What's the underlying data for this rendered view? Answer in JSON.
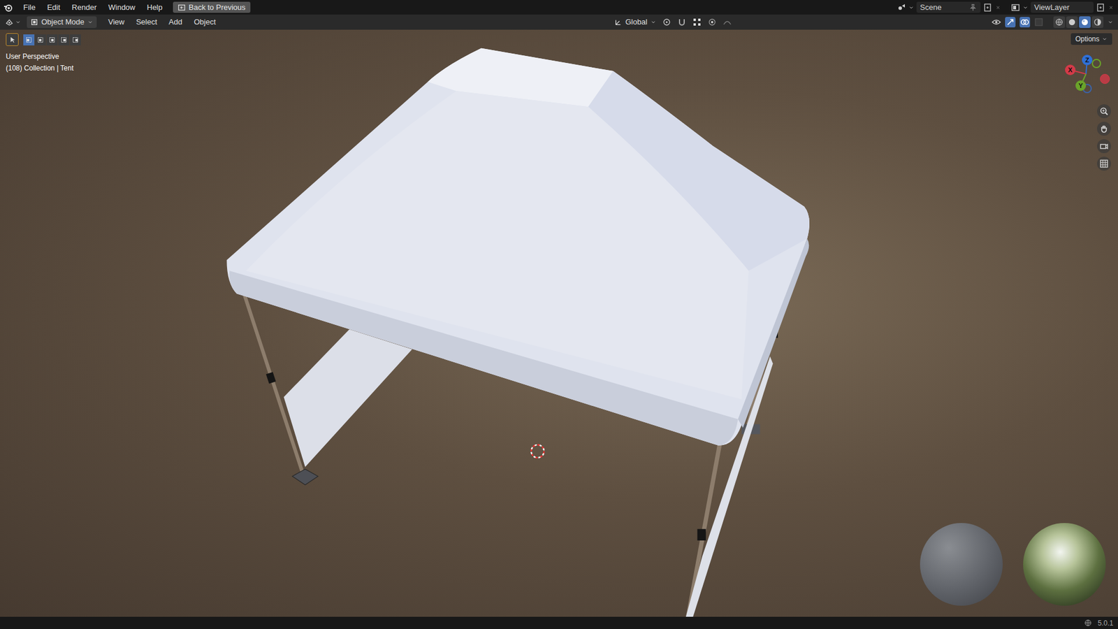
{
  "topbar": {
    "menus": [
      "File",
      "Edit",
      "Render",
      "Window",
      "Help"
    ],
    "back_button": "Back to Previous",
    "scene": "Scene",
    "view_layer": "ViewLayer"
  },
  "header": {
    "mode": "Object Mode",
    "menus": [
      "View",
      "Select",
      "Add",
      "Object"
    ],
    "orientation": "Global"
  },
  "select_modes": [
    {
      "selected": true
    },
    {
      "selected": false
    },
    {
      "selected": false
    },
    {
      "selected": false
    },
    {
      "selected": false
    }
  ],
  "shading_modes": [
    {
      "selected": false
    },
    {
      "selected": false
    },
    {
      "selected": true
    },
    {
      "selected": false
    }
  ],
  "tool_options": "Options",
  "viewport": {
    "view_name": "User Perspective",
    "object_info": "(108) Collection | Tent"
  },
  "gizmo": {
    "x": "X",
    "y": "Y",
    "z": "Z"
  },
  "status_bar": {
    "version": "5.0.1"
  }
}
